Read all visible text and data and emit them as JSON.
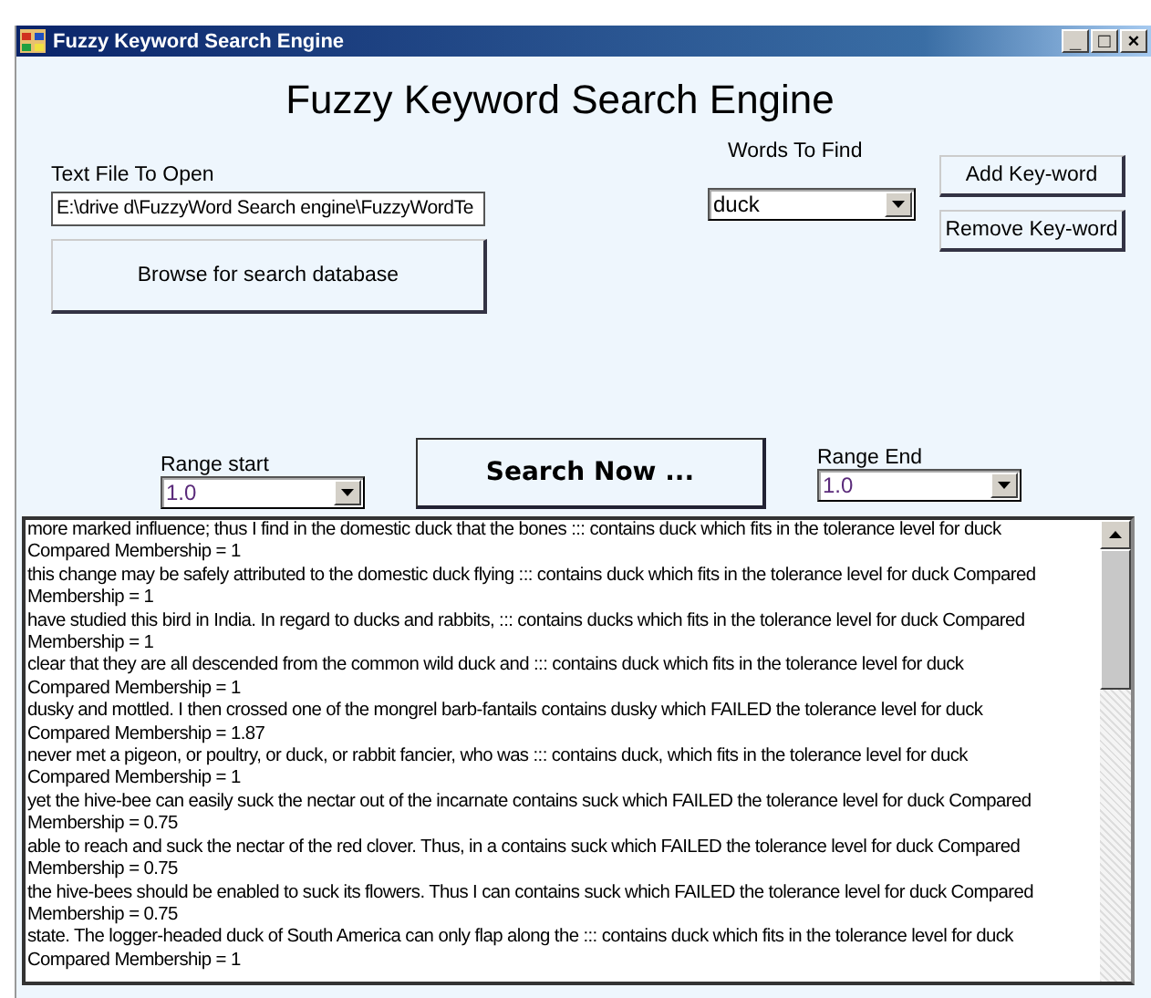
{
  "window": {
    "title": "Fuzzy Keyword Search Engine",
    "controls": [
      "_",
      "□",
      "×"
    ]
  },
  "heading": "Fuzzy Keyword Search Engine",
  "file": {
    "label": "Text File To Open",
    "value": "E:\\drive d\\FuzzyWord Search engine\\FuzzyWordTe",
    "browse_button": "Browse for search database"
  },
  "words": {
    "label": "Words To Find",
    "value": "duck"
  },
  "keyword_buttons": [
    "Add Key-word",
    "Remove Key-word"
  ],
  "range_start": {
    "label": "Range start",
    "value": "1.0"
  },
  "search_button": "Search Now ...",
  "range_end": {
    "label": "Range End",
    "value": "1.0"
  },
  "results": [
    {
      "text": "more marked influence; thus I find in the domestic duck that the bones ::: contains duck which fits in the tolerance level for duck",
      "membership": "Compared Membership = 1"
    },
    {
      "text": "this change may be safely attributed to the domestic duck flying ::: contains duck which fits in the tolerance level for duck Compared",
      "membership": "Membership = 1"
    },
    {
      "text": "have studied this bird in India. In regard to ducks and rabbits, ::: contains ducks which fits in the tolerance level for duck Compared",
      "membership": "Membership = 1"
    },
    {
      "text": "clear that they are all descended from the common wild duck and ::: contains duck which fits in the tolerance level for duck",
      "membership": "Compared Membership = 1"
    },
    {
      "text": "dusky and mottled. I then crossed one of the mongrel barb-fantails contains dusky which FAILED the tolerance level for duck",
      "membership": "Compared Membership = 1.87"
    },
    {
      "text": "never met a pigeon, or poultry, or duck, or rabbit fancier, who was ::: contains duck, which fits in the tolerance level for duck",
      "membership": "Compared Membership = 1"
    },
    {
      "text": "yet the hive-bee can easily suck the nectar out of the incarnate contains suck which FAILED the tolerance level for duck Compared",
      "membership": "Membership = 0.75"
    },
    {
      "text": "able to reach and suck the nectar of the red clover. Thus, in a contains suck which FAILED the tolerance level for duck Compared",
      "membership": "Membership = 0.75"
    },
    {
      "text": "the hive-bees should be enabled to suck its flowers. Thus I can contains suck which FAILED the tolerance level for duck Compared",
      "membership": "Membership = 0.75"
    },
    {
      "text": "state. The logger-headed duck of South America can only flap along the ::: contains duck which fits in the tolerance level for duck",
      "membership": "Compared Membership = 1"
    }
  ]
}
